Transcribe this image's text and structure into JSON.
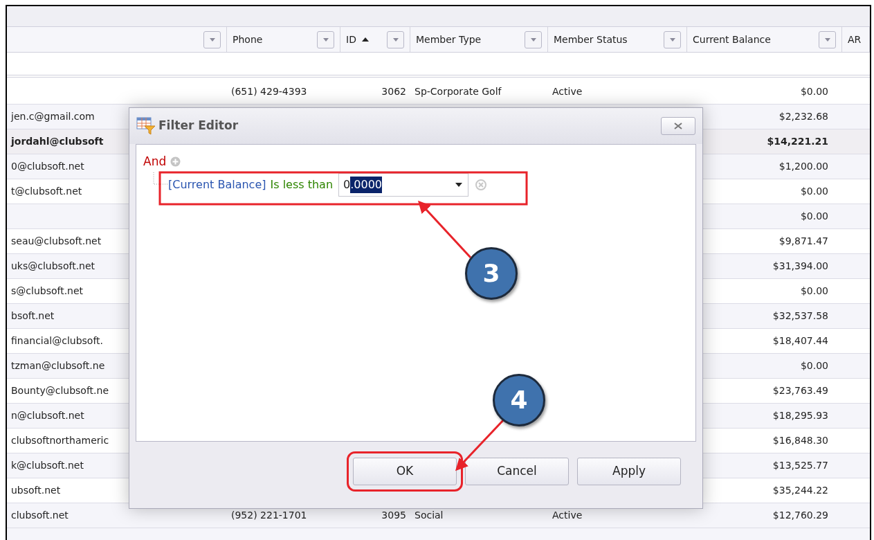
{
  "grid": {
    "columns": [
      {
        "has_filter_button": true
      },
      {
        "label": "Phone",
        "has_filter_button": true
      },
      {
        "label": "ID",
        "sort_ascending": true,
        "has_filter_button": true
      },
      {
        "label": "Member Type",
        "has_filter_button": true
      },
      {
        "label": "Member Status",
        "has_filter_button": true
      },
      {
        "label": "Current Balance",
        "has_filter_button": true
      },
      {
        "label": "AR",
        "has_filter_button": false
      }
    ],
    "rows": [
      {
        "selected": false,
        "phone": "(651) 429-4393",
        "id": "3062",
        "member_type": "Sp-Corporate Golf",
        "member_status": "Active",
        "current_balance": "$0.00"
      },
      {
        "selected": false,
        "column_1": "jen.c@gmail.com",
        "current_balance": "$2,232.68"
      },
      {
        "selected": true,
        "column_1": "jordahl@clubsoft",
        "current_balance": "$14,221.21"
      },
      {
        "selected": false,
        "column_1": "0@clubsoft.net",
        "current_balance": "$1,200.00"
      },
      {
        "selected": false,
        "column_1": "t@clubsoft.net",
        "current_balance": "$0.00"
      },
      {
        "selected": false,
        "current_balance": "$0.00"
      },
      {
        "selected": false,
        "column_1": "seau@clubsoft.net",
        "current_balance": "$9,871.47"
      },
      {
        "selected": false,
        "column_1": "uks@clubsoft.net",
        "current_balance": "$31,394.00"
      },
      {
        "selected": false,
        "column_1": "s@clubsoft.net",
        "current_balance": "$0.00"
      },
      {
        "selected": false,
        "column_1": "bsoft.net",
        "current_balance": "$32,537.58"
      },
      {
        "selected": false,
        "column_1": "financial@clubsoft.",
        "current_balance": "$18,407.44"
      },
      {
        "selected": false,
        "column_1": "tzman@clubsoft.ne",
        "current_balance": "$0.00"
      },
      {
        "selected": false,
        "column_1": "Bounty@clubsoft.ne",
        "current_balance": "$23,763.49"
      },
      {
        "selected": false,
        "column_1": "n@clubsoft.net",
        "current_balance": "$18,295.93"
      },
      {
        "selected": false,
        "column_1": "clubsoftnorthameric",
        "current_balance": "$16,848.30"
      },
      {
        "selected": false,
        "column_1": "k@clubsoft.net",
        "current_balance": "$13,525.77"
      },
      {
        "selected": false,
        "column_1": "ubsoft.net",
        "current_balance": "$35,244.22"
      },
      {
        "selected": false,
        "column_1": "clubsoft.net",
        "phone": "(952) 221-1701",
        "id": "3095",
        "member_type": "Social",
        "member_status": "Active",
        "current_balance": "$12,760.29"
      }
    ]
  },
  "dialog": {
    "title": "Filter Editor",
    "group_operator": "And",
    "condition": {
      "field": "[Current Balance]",
      "operator": "Is less than",
      "value_parts": [
        {
          "text": "0",
          "selected": false
        },
        {
          "text": ".0000",
          "selected": true
        }
      ]
    },
    "buttons": [
      {
        "label": "OK",
        "highlighted": true
      },
      {
        "label": "Cancel",
        "highlighted": false
      },
      {
        "label": "Apply",
        "highlighted": false
      }
    ]
  },
  "callouts": [
    {
      "number": "3"
    },
    {
      "number": "4"
    }
  ]
}
